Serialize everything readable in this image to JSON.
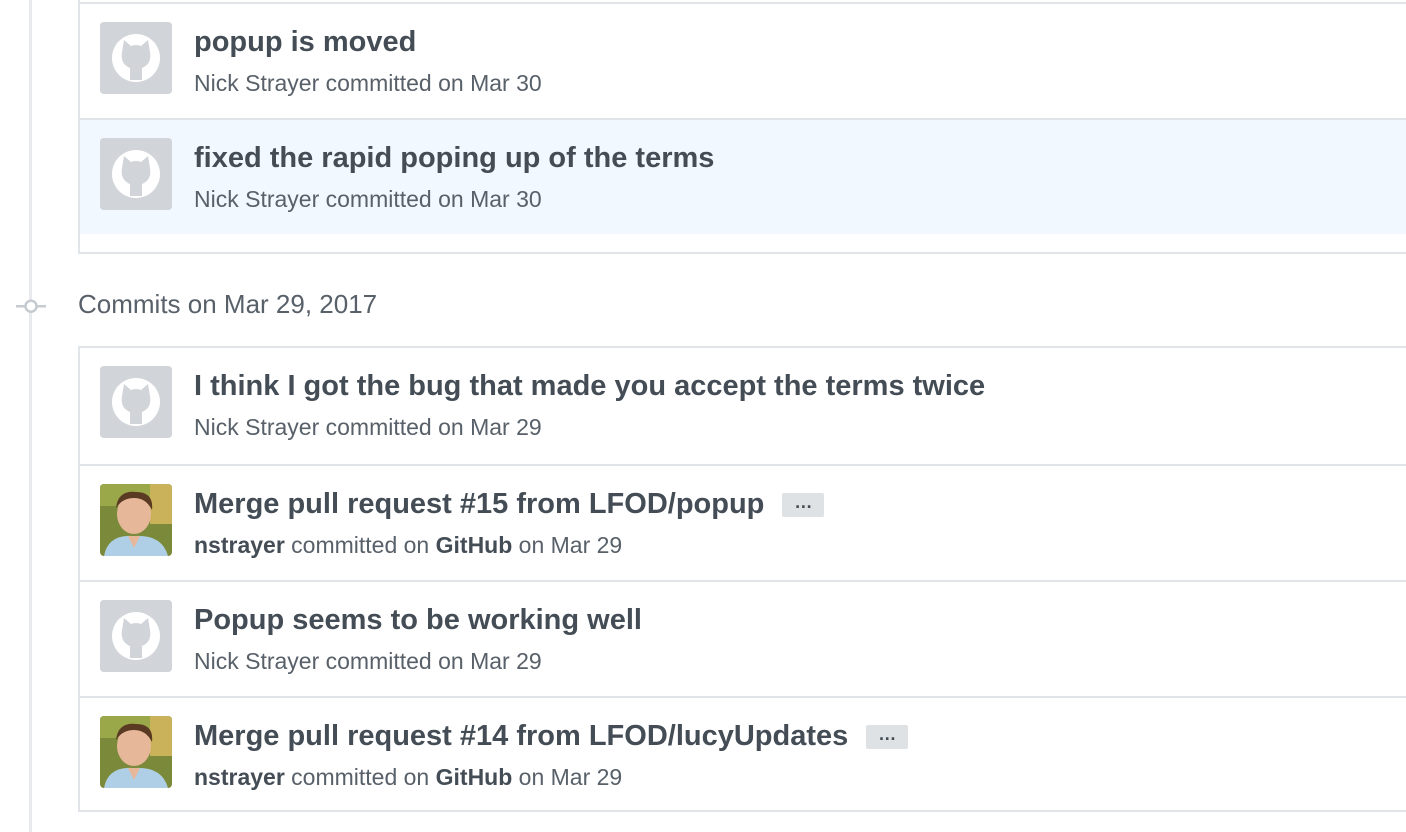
{
  "icons": {
    "default_avatar": "octocat-icon",
    "user_avatar": "user-photo-avatar",
    "timeline_node": "git-commit-icon",
    "ellipsis": "ellipsis-icon"
  },
  "groups": [
    {
      "heading": "",
      "commits": [
        {
          "message": "popup is moved",
          "author": "Nick Strayer",
          "verb": "committed",
          "via": "",
          "date": "on Mar 30"
        },
        {
          "message": "fixed the rapid poping up of the terms",
          "author": "Nick Strayer",
          "verb": "committed",
          "via": "",
          "date": "on Mar 30"
        }
      ]
    },
    {
      "heading": "Commits on Mar 29, 2017",
      "commits": [
        {
          "message": "I think I got the bug that made you accept the terms twice",
          "author": "Nick Strayer",
          "verb": "committed",
          "via": "",
          "date": "on Mar 29"
        },
        {
          "message": "Merge pull request #15 from LFOD/popup",
          "author": "nstrayer",
          "verb": "committed on",
          "via": "GitHub",
          "date": "on Mar 29",
          "ellipsis": "…"
        },
        {
          "message": "Popup seems to be working well",
          "author": "Nick Strayer",
          "verb": "committed",
          "via": "",
          "date": "on Mar 29"
        },
        {
          "message": "Merge pull request #14 from LFOD/lucyUpdates",
          "author": "nstrayer",
          "verb": "committed on",
          "via": "GitHub",
          "date": "on Mar 29",
          "ellipsis": "…"
        }
      ]
    }
  ]
}
